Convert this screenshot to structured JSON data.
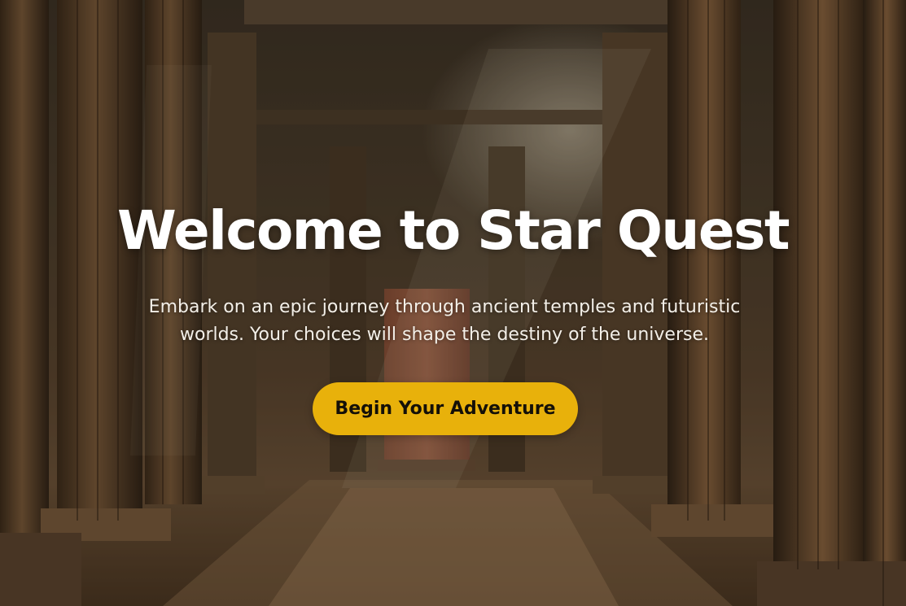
{
  "hero": {
    "title": "Welcome to Star Quest",
    "subtitle": "Embark on an epic journey through ancient temples and futuristic worlds. Your choices will shape the destiny of the universe.",
    "cta_label": "Begin Your Adventure"
  },
  "colors": {
    "accent": "#e8b10b",
    "title_text": "#ffffff",
    "button_text": "#141008"
  },
  "background": {
    "image_description_icon": "temple-columns-background"
  }
}
